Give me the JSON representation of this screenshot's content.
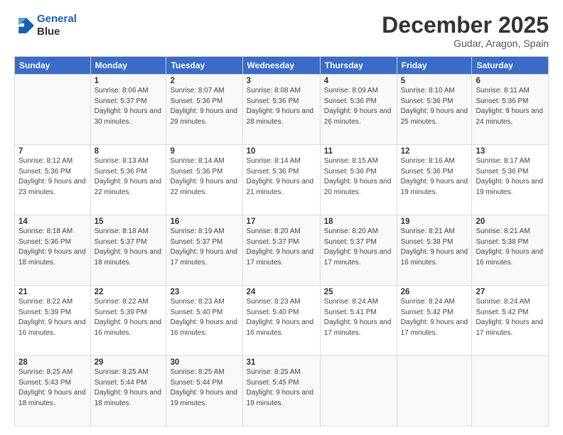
{
  "header": {
    "logo_line1": "General",
    "logo_line2": "Blue",
    "month": "December 2025",
    "location": "Gudar, Aragon, Spain"
  },
  "weekdays": [
    "Sunday",
    "Monday",
    "Tuesday",
    "Wednesday",
    "Thursday",
    "Friday",
    "Saturday"
  ],
  "weeks": [
    [
      {
        "day": "",
        "sunrise": "",
        "sunset": "",
        "daylight": ""
      },
      {
        "day": "1",
        "sunrise": "Sunrise: 8:06 AM",
        "sunset": "Sunset: 5:37 PM",
        "daylight": "Daylight: 9 hours and 30 minutes."
      },
      {
        "day": "2",
        "sunrise": "Sunrise: 8:07 AM",
        "sunset": "Sunset: 5:36 PM",
        "daylight": "Daylight: 9 hours and 29 minutes."
      },
      {
        "day": "3",
        "sunrise": "Sunrise: 8:08 AM",
        "sunset": "Sunset: 5:36 PM",
        "daylight": "Daylight: 9 hours and 28 minutes."
      },
      {
        "day": "4",
        "sunrise": "Sunrise: 8:09 AM",
        "sunset": "Sunset: 5:36 PM",
        "daylight": "Daylight: 9 hours and 26 minutes."
      },
      {
        "day": "5",
        "sunrise": "Sunrise: 8:10 AM",
        "sunset": "Sunset: 5:36 PM",
        "daylight": "Daylight: 9 hours and 25 minutes."
      },
      {
        "day": "6",
        "sunrise": "Sunrise: 8:11 AM",
        "sunset": "Sunset: 5:36 PM",
        "daylight": "Daylight: 9 hours and 24 minutes."
      }
    ],
    [
      {
        "day": "7",
        "sunrise": "Sunrise: 8:12 AM",
        "sunset": "Sunset: 5:36 PM",
        "daylight": "Daylight: 9 hours and 23 minutes."
      },
      {
        "day": "8",
        "sunrise": "Sunrise: 8:13 AM",
        "sunset": "Sunset: 5:36 PM",
        "daylight": "Daylight: 9 hours and 22 minutes."
      },
      {
        "day": "9",
        "sunrise": "Sunrise: 8:14 AM",
        "sunset": "Sunset: 5:36 PM",
        "daylight": "Daylight: 9 hours and 22 minutes."
      },
      {
        "day": "10",
        "sunrise": "Sunrise: 8:14 AM",
        "sunset": "Sunset: 5:36 PM",
        "daylight": "Daylight: 9 hours and 21 minutes."
      },
      {
        "day": "11",
        "sunrise": "Sunrise: 8:15 AM",
        "sunset": "Sunset: 5:36 PM",
        "daylight": "Daylight: 9 hours and 20 minutes."
      },
      {
        "day": "12",
        "sunrise": "Sunrise: 8:16 AM",
        "sunset": "Sunset: 5:36 PM",
        "daylight": "Daylight: 9 hours and 19 minutes."
      },
      {
        "day": "13",
        "sunrise": "Sunrise: 8:17 AM",
        "sunset": "Sunset: 5:36 PM",
        "daylight": "Daylight: 9 hours and 19 minutes."
      }
    ],
    [
      {
        "day": "14",
        "sunrise": "Sunrise: 8:18 AM",
        "sunset": "Sunset: 5:36 PM",
        "daylight": "Daylight: 9 hours and 18 minutes."
      },
      {
        "day": "15",
        "sunrise": "Sunrise: 8:18 AM",
        "sunset": "Sunset: 5:37 PM",
        "daylight": "Daylight: 9 hours and 18 minutes."
      },
      {
        "day": "16",
        "sunrise": "Sunrise: 8:19 AM",
        "sunset": "Sunset: 5:37 PM",
        "daylight": "Daylight: 9 hours and 17 minutes."
      },
      {
        "day": "17",
        "sunrise": "Sunrise: 8:20 AM",
        "sunset": "Sunset: 5:37 PM",
        "daylight": "Daylight: 9 hours and 17 minutes."
      },
      {
        "day": "18",
        "sunrise": "Sunrise: 8:20 AM",
        "sunset": "Sunset: 5:37 PM",
        "daylight": "Daylight: 9 hours and 17 minutes."
      },
      {
        "day": "19",
        "sunrise": "Sunrise: 8:21 AM",
        "sunset": "Sunset: 5:38 PM",
        "daylight": "Daylight: 9 hours and 16 minutes."
      },
      {
        "day": "20",
        "sunrise": "Sunrise: 8:21 AM",
        "sunset": "Sunset: 5:38 PM",
        "daylight": "Daylight: 9 hours and 16 minutes."
      }
    ],
    [
      {
        "day": "21",
        "sunrise": "Sunrise: 8:22 AM",
        "sunset": "Sunset: 5:39 PM",
        "daylight": "Daylight: 9 hours and 16 minutes."
      },
      {
        "day": "22",
        "sunrise": "Sunrise: 8:22 AM",
        "sunset": "Sunset: 5:39 PM",
        "daylight": "Daylight: 9 hours and 16 minutes."
      },
      {
        "day": "23",
        "sunrise": "Sunrise: 8:23 AM",
        "sunset": "Sunset: 5:40 PM",
        "daylight": "Daylight: 9 hours and 16 minutes."
      },
      {
        "day": "24",
        "sunrise": "Sunrise: 8:23 AM",
        "sunset": "Sunset: 5:40 PM",
        "daylight": "Daylight: 9 hours and 16 minutes."
      },
      {
        "day": "25",
        "sunrise": "Sunrise: 8:24 AM",
        "sunset": "Sunset: 5:41 PM",
        "daylight": "Daylight: 9 hours and 17 minutes."
      },
      {
        "day": "26",
        "sunrise": "Sunrise: 8:24 AM",
        "sunset": "Sunset: 5:42 PM",
        "daylight": "Daylight: 9 hours and 17 minutes."
      },
      {
        "day": "27",
        "sunrise": "Sunrise: 8:24 AM",
        "sunset": "Sunset: 5:42 PM",
        "daylight": "Daylight: 9 hours and 17 minutes."
      }
    ],
    [
      {
        "day": "28",
        "sunrise": "Sunrise: 8:25 AM",
        "sunset": "Sunset: 5:43 PM",
        "daylight": "Daylight: 9 hours and 18 minutes."
      },
      {
        "day": "29",
        "sunrise": "Sunrise: 8:25 AM",
        "sunset": "Sunset: 5:44 PM",
        "daylight": "Daylight: 9 hours and 18 minutes."
      },
      {
        "day": "30",
        "sunrise": "Sunrise: 8:25 AM",
        "sunset": "Sunset: 5:44 PM",
        "daylight": "Daylight: 9 hours and 19 minutes."
      },
      {
        "day": "31",
        "sunrise": "Sunrise: 8:25 AM",
        "sunset": "Sunset: 5:45 PM",
        "daylight": "Daylight: 9 hours and 19 minutes."
      },
      {
        "day": "",
        "sunrise": "",
        "sunset": "",
        "daylight": ""
      },
      {
        "day": "",
        "sunrise": "",
        "sunset": "",
        "daylight": ""
      },
      {
        "day": "",
        "sunrise": "",
        "sunset": "",
        "daylight": ""
      }
    ]
  ]
}
